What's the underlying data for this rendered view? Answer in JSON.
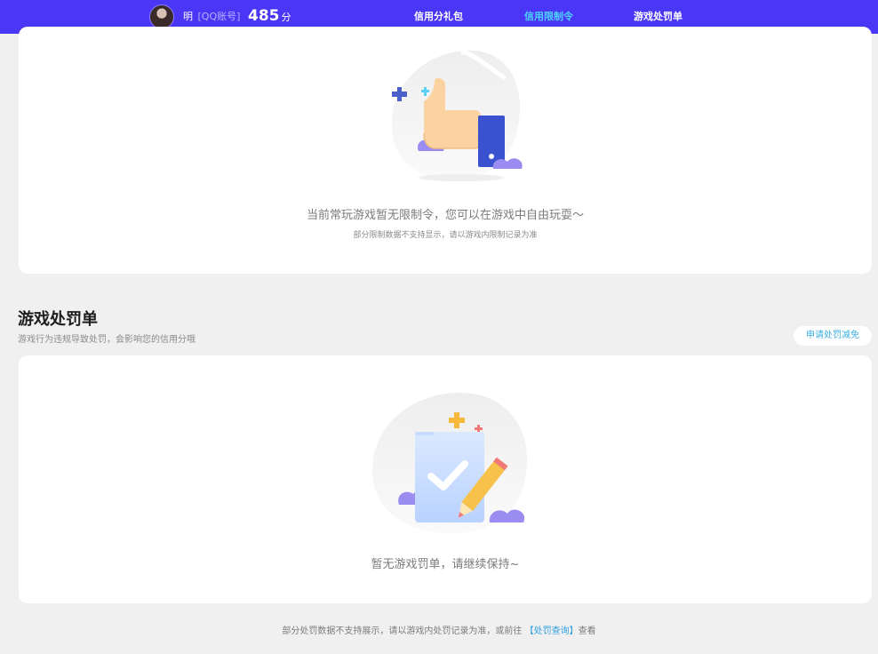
{
  "header": {
    "user_name": "明",
    "account_type": "[QQ账号]",
    "score_value": "485",
    "score_unit": "分",
    "tabs": [
      {
        "label": "信用分礼包",
        "active": false
      },
      {
        "label": "信用限制令",
        "active": true
      },
      {
        "label": "游戏处罚单",
        "active": false
      }
    ]
  },
  "restriction": {
    "empty_message": "当前常玩游戏暂无限制令，您可以在游戏中自由玩耍～",
    "note": "部分限制数据不支持显示，请以游戏内限制记录为准"
  },
  "penalty": {
    "title": "游戏处罚单",
    "subtitle": "游戏行为违规导致处罚，会影响您的信用分哦",
    "apply_button": "申请处罚减免",
    "empty_message": "暂无游戏罚单，请继续保持~"
  },
  "footer": {
    "text_before": "部分处罚数据不支持展示，请以游戏内处罚记录为准，或前往 ",
    "link_text": "【处罚查询】",
    "text_after": "查看"
  },
  "colors": {
    "header_bg": "#4a36f5",
    "active_tab": "#4fd2ff",
    "link": "#2f9fe0",
    "page_bg": "#f0f0f0"
  }
}
